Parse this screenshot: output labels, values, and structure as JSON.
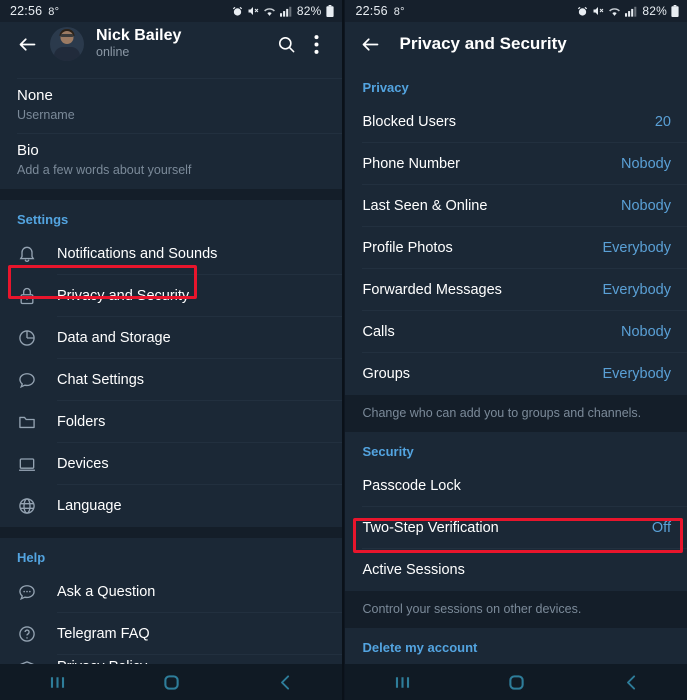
{
  "status_bar": {
    "time": "22:56",
    "temperature": "8°",
    "battery": "82%",
    "icons": [
      "alarm-icon",
      "mute-icon",
      "wifi-icon",
      "signal-icon",
      "battery-icon"
    ]
  },
  "left_panel": {
    "app_bar": {
      "back": "back-arrow-icon",
      "name": "Nick Bailey",
      "status": "online",
      "search": "search-icon",
      "more": "more-vertical-icon"
    },
    "profile_rows": [
      {
        "primary": "None",
        "secondary": "Username"
      },
      {
        "primary": "Bio",
        "secondary": "Add a few words about yourself"
      }
    ],
    "settings": {
      "header": "Settings",
      "items": [
        {
          "label": "Notifications and Sounds",
          "icon": "bell-icon"
        },
        {
          "label": "Privacy and Security",
          "icon": "lock-icon",
          "highlighted": true
        },
        {
          "label": "Data and Storage",
          "icon": "pie-chart-icon"
        },
        {
          "label": "Chat Settings",
          "icon": "chat-bubble-icon"
        },
        {
          "label": "Folders",
          "icon": "folder-icon"
        },
        {
          "label": "Devices",
          "icon": "laptop-icon"
        },
        {
          "label": "Language",
          "icon": "globe-icon"
        }
      ]
    },
    "help": {
      "header": "Help",
      "items": [
        {
          "label": "Ask a Question",
          "icon": "chat-dots-icon"
        },
        {
          "label": "Telegram FAQ",
          "icon": "question-circle-icon"
        },
        {
          "label": "Privacy Policy",
          "icon": "shield-icon"
        }
      ]
    }
  },
  "right_panel": {
    "app_bar": {
      "back": "back-arrow-icon",
      "title": "Privacy and Security"
    },
    "privacy": {
      "header": "Privacy",
      "items": [
        {
          "label": "Blocked Users",
          "value": "20"
        },
        {
          "label": "Phone Number",
          "value": "Nobody"
        },
        {
          "label": "Last Seen & Online",
          "value": "Nobody"
        },
        {
          "label": "Profile Photos",
          "value": "Everybody"
        },
        {
          "label": "Forwarded Messages",
          "value": "Everybody"
        },
        {
          "label": "Calls",
          "value": "Nobody"
        },
        {
          "label": "Groups",
          "value": "Everybody"
        }
      ],
      "hint": "Change who can add you to groups and channels."
    },
    "security": {
      "header": "Security",
      "items": [
        {
          "label": "Passcode Lock",
          "value": ""
        },
        {
          "label": "Two-Step Verification",
          "value": "Off",
          "highlighted": true
        },
        {
          "label": "Active Sessions",
          "value": ""
        }
      ],
      "hint": "Control your sessions on other devices."
    },
    "delete": {
      "header": "Delete my account"
    }
  },
  "nav_bar": {
    "recents": "recents-icon",
    "home": "home-icon",
    "back": "back-chevron-icon"
  },
  "colors": {
    "accent": "#53a4e0",
    "value": "#5aa0d6",
    "highlight": "#e8152c",
    "panel_bg": "#1b2836",
    "band_bg": "#141e29",
    "nav_tint": "#2e7d9a"
  }
}
